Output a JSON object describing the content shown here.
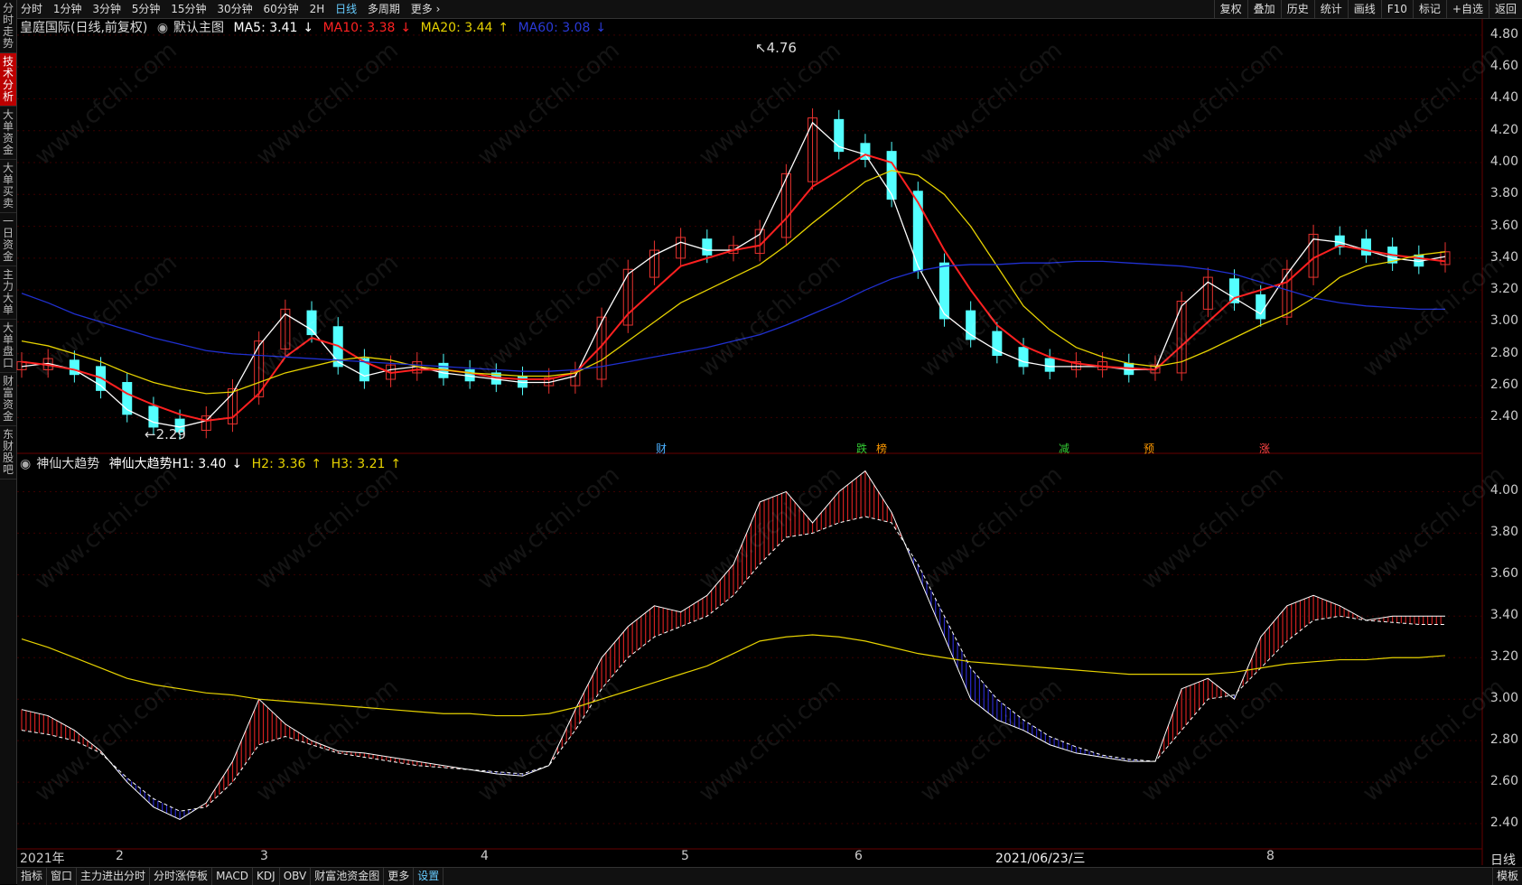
{
  "sidebar": {
    "items": [
      {
        "label": "分时走势"
      },
      {
        "label": "技术分析"
      },
      {
        "label": "大单资金"
      },
      {
        "label": "大单买卖"
      },
      {
        "label": "一日资金"
      },
      {
        "label": "主力大单"
      },
      {
        "label": "大单盘口"
      },
      {
        "label": "财富资金"
      },
      {
        "label": "东财股吧"
      }
    ]
  },
  "topbar": {
    "periods": [
      "分时",
      "1分钟",
      "3分钟",
      "5分钟",
      "15分钟",
      "30分钟",
      "60分钟",
      "2H",
      "日线",
      "多周期",
      "更多"
    ],
    "active_period": "日线",
    "right": [
      "复权",
      "叠加",
      "历史",
      "统计",
      "画线",
      "F10",
      "标记",
      "+自选",
      "返回"
    ]
  },
  "main_legend": {
    "stock": "皇庭国际(日线,前复权)",
    "chart_name": "默认主图",
    "ma5": "MA5: 3.41",
    "ma10": "MA10: 3.38",
    "ma20": "MA20: 3.44",
    "ma60": "MA60: 3.08"
  },
  "sub_legend": {
    "name": "神仙大趋势",
    "h1": "神仙大趋势H1: 3.40",
    "h2": "H2: 3.36",
    "h3": "H3: 3.21"
  },
  "annotations": {
    "high": "4.76",
    "low": "2.29"
  },
  "event_markers": [
    {
      "text": "财",
      "color": "#4bb0ff"
    },
    {
      "text": "跌",
      "color": "#3c3"
    },
    {
      "text": "榜",
      "color": "#f90"
    },
    {
      "text": "减",
      "color": "#3c3"
    },
    {
      "text": "预",
      "color": "#f90"
    },
    {
      "text": "涨",
      "color": "#f44"
    }
  ],
  "main_axis": [
    "4.80",
    "4.60",
    "4.40",
    "4.20",
    "4.00",
    "3.80",
    "3.60",
    "3.40",
    "3.20",
    "3.00",
    "2.80",
    "2.60",
    "2.40"
  ],
  "sub_axis": [
    "4.00",
    "3.80",
    "3.60",
    "3.40",
    "3.20",
    "3.00",
    "2.80",
    "2.60",
    "2.40"
  ],
  "x_labels": [
    "2021年",
    "2",
    "3",
    "4",
    "5",
    "6",
    "2021/06/23/三",
    "8"
  ],
  "bottom_tabs": [
    "指标",
    "窗口",
    "主力进出分时",
    "分时涨停板",
    "MACD",
    "KDJ",
    "OBV",
    "财富池资金图",
    "更多",
    "设置"
  ],
  "bottom_active": "设置",
  "right_corner": {
    "period": "日线",
    "template": "模板"
  },
  "watermark": "www.cfchi.com",
  "colors": {
    "up": "#e8322f",
    "down": "#54ffff",
    "ma5": "#ffffff",
    "ma10": "#ff2020",
    "ma20": "#e6d200",
    "ma60": "#2030d0",
    "h_up": "#d02020",
    "h_down": "#2828c8"
  },
  "chart_data": [
    {
      "type": "candlestick",
      "title": "皇庭国际(日线,前复权)",
      "ylim": [
        2.3,
        4.85
      ],
      "series": [
        {
          "name": "MA5",
          "values": [
            2.72,
            2.74,
            2.7,
            2.6,
            2.45,
            2.37,
            2.34,
            2.38,
            2.55,
            2.85,
            3.05,
            2.95,
            2.75,
            2.66,
            2.7,
            2.72,
            2.68,
            2.66,
            2.64,
            2.62,
            2.62,
            2.66,
            3.0,
            3.3,
            3.42,
            3.5,
            3.45,
            3.45,
            3.55,
            3.9,
            4.25,
            4.1,
            4.05,
            3.8,
            3.35,
            3.05,
            2.92,
            2.82,
            2.75,
            2.72,
            2.72,
            2.72,
            2.7,
            2.7,
            3.1,
            3.25,
            3.15,
            3.05,
            3.3,
            3.52,
            3.5,
            3.45,
            3.4,
            3.38,
            3.41
          ]
        },
        {
          "name": "MA10",
          "values": [
            2.75,
            2.73,
            2.7,
            2.65,
            2.55,
            2.48,
            2.42,
            2.38,
            2.4,
            2.55,
            2.78,
            2.9,
            2.85,
            2.75,
            2.68,
            2.7,
            2.7,
            2.68,
            2.65,
            2.64,
            2.64,
            2.68,
            2.85,
            3.05,
            3.2,
            3.35,
            3.4,
            3.45,
            3.48,
            3.65,
            3.85,
            3.95,
            4.05,
            4.0,
            3.75,
            3.45,
            3.2,
            2.98,
            2.85,
            2.78,
            2.74,
            2.72,
            2.71,
            2.7,
            2.85,
            3.0,
            3.15,
            3.2,
            3.25,
            3.4,
            3.48,
            3.45,
            3.42,
            3.4,
            3.38
          ]
        },
        {
          "name": "MA20",
          "values": [
            2.88,
            2.85,
            2.8,
            2.75,
            2.68,
            2.62,
            2.58,
            2.55,
            2.56,
            2.62,
            2.68,
            2.72,
            2.76,
            2.78,
            2.76,
            2.72,
            2.7,
            2.68,
            2.67,
            2.66,
            2.66,
            2.68,
            2.76,
            2.88,
            3.0,
            3.12,
            3.2,
            3.28,
            3.36,
            3.48,
            3.62,
            3.75,
            3.88,
            3.95,
            3.92,
            3.8,
            3.6,
            3.35,
            3.1,
            2.95,
            2.84,
            2.78,
            2.74,
            2.72,
            2.75,
            2.82,
            2.9,
            2.98,
            3.05,
            3.15,
            3.28,
            3.35,
            3.38,
            3.42,
            3.44
          ]
        },
        {
          "name": "MA60",
          "values": [
            3.18,
            3.12,
            3.05,
            3.0,
            2.95,
            2.9,
            2.86,
            2.82,
            2.8,
            2.79,
            2.78,
            2.77,
            2.76,
            2.75,
            2.74,
            2.73,
            2.72,
            2.71,
            2.7,
            2.69,
            2.69,
            2.7,
            2.72,
            2.75,
            2.78,
            2.81,
            2.84,
            2.88,
            2.92,
            2.98,
            3.05,
            3.12,
            3.2,
            3.27,
            3.32,
            3.35,
            3.36,
            3.36,
            3.37,
            3.37,
            3.38,
            3.38,
            3.37,
            3.36,
            3.35,
            3.33,
            3.3,
            3.25,
            3.2,
            3.15,
            3.12,
            3.1,
            3.09,
            3.08,
            3.08
          ]
        }
      ]
    },
    {
      "type": "area",
      "title": "神仙大趋势",
      "ylim": [
        2.3,
        4.15
      ],
      "series": [
        {
          "name": "H1",
          "values": [
            2.95,
            2.92,
            2.85,
            2.75,
            2.6,
            2.48,
            2.42,
            2.5,
            2.7,
            3.0,
            2.88,
            2.8,
            2.75,
            2.74,
            2.72,
            2.7,
            2.68,
            2.66,
            2.64,
            2.63,
            2.68,
            2.95,
            3.2,
            3.35,
            3.45,
            3.42,
            3.5,
            3.65,
            3.95,
            4.0,
            3.85,
            4.0,
            4.1,
            3.9,
            3.6,
            3.3,
            3.0,
            2.9,
            2.85,
            2.78,
            2.74,
            2.72,
            2.7,
            2.7,
            3.05,
            3.1,
            3.0,
            3.3,
            3.45,
            3.5,
            3.45,
            3.38,
            3.4,
            3.4,
            3.4
          ]
        },
        {
          "name": "H2",
          "values": [
            2.85,
            2.83,
            2.8,
            2.74,
            2.62,
            2.52,
            2.46,
            2.48,
            2.6,
            2.78,
            2.82,
            2.78,
            2.74,
            2.72,
            2.7,
            2.68,
            2.67,
            2.66,
            2.65,
            2.64,
            2.68,
            2.85,
            3.05,
            3.2,
            3.3,
            3.35,
            3.4,
            3.5,
            3.65,
            3.78,
            3.8,
            3.85,
            3.88,
            3.85,
            3.65,
            3.4,
            3.15,
            3.0,
            2.9,
            2.82,
            2.77,
            2.73,
            2.71,
            2.7,
            2.85,
            3.0,
            3.02,
            3.15,
            3.28,
            3.38,
            3.4,
            3.38,
            3.37,
            3.36,
            3.36
          ]
        },
        {
          "name": "H3",
          "values": [
            3.29,
            3.25,
            3.2,
            3.15,
            3.1,
            3.07,
            3.05,
            3.03,
            3.02,
            3.0,
            2.99,
            2.98,
            2.97,
            2.96,
            2.95,
            2.94,
            2.93,
            2.93,
            2.92,
            2.92,
            2.93,
            2.96,
            3.0,
            3.04,
            3.08,
            3.12,
            3.16,
            3.22,
            3.28,
            3.3,
            3.31,
            3.3,
            3.28,
            3.25,
            3.22,
            3.2,
            3.18,
            3.17,
            3.16,
            3.15,
            3.14,
            3.13,
            3.12,
            3.12,
            3.12,
            3.12,
            3.13,
            3.15,
            3.17,
            3.18,
            3.19,
            3.19,
            3.2,
            3.2,
            3.21
          ]
        }
      ]
    }
  ]
}
